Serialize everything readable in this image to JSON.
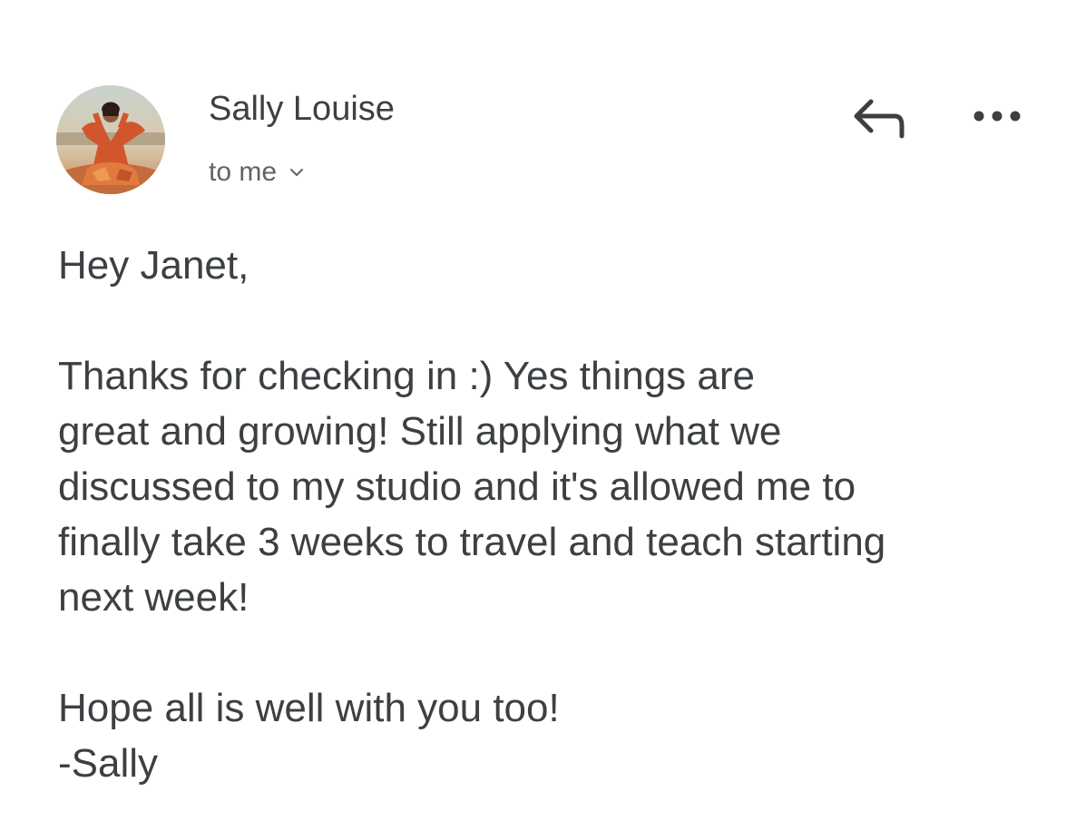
{
  "message": {
    "sender": {
      "name": "Sally Louise",
      "avatar_icon": "profile-photo"
    },
    "recipient_label": "to me",
    "actions": {
      "reply_icon": "reply-icon",
      "more_icon": "more-horizontal-icon"
    },
    "body": {
      "greeting": "Hey Janet,",
      "paragraph_lines": [
        "Thanks for checking in :) Yes things are",
        "great and growing!  Still applying what we",
        "discussed to my studio and it's allowed me to",
        "finally take 3 weeks to travel and teach starting",
        "next week!"
      ],
      "closing": "Hope all is well with you too!",
      "signature": "-Sally"
    }
  },
  "colors": {
    "text_primary": "#3c4043",
    "text_secondary": "#5f6368",
    "background": "#ffffff"
  }
}
